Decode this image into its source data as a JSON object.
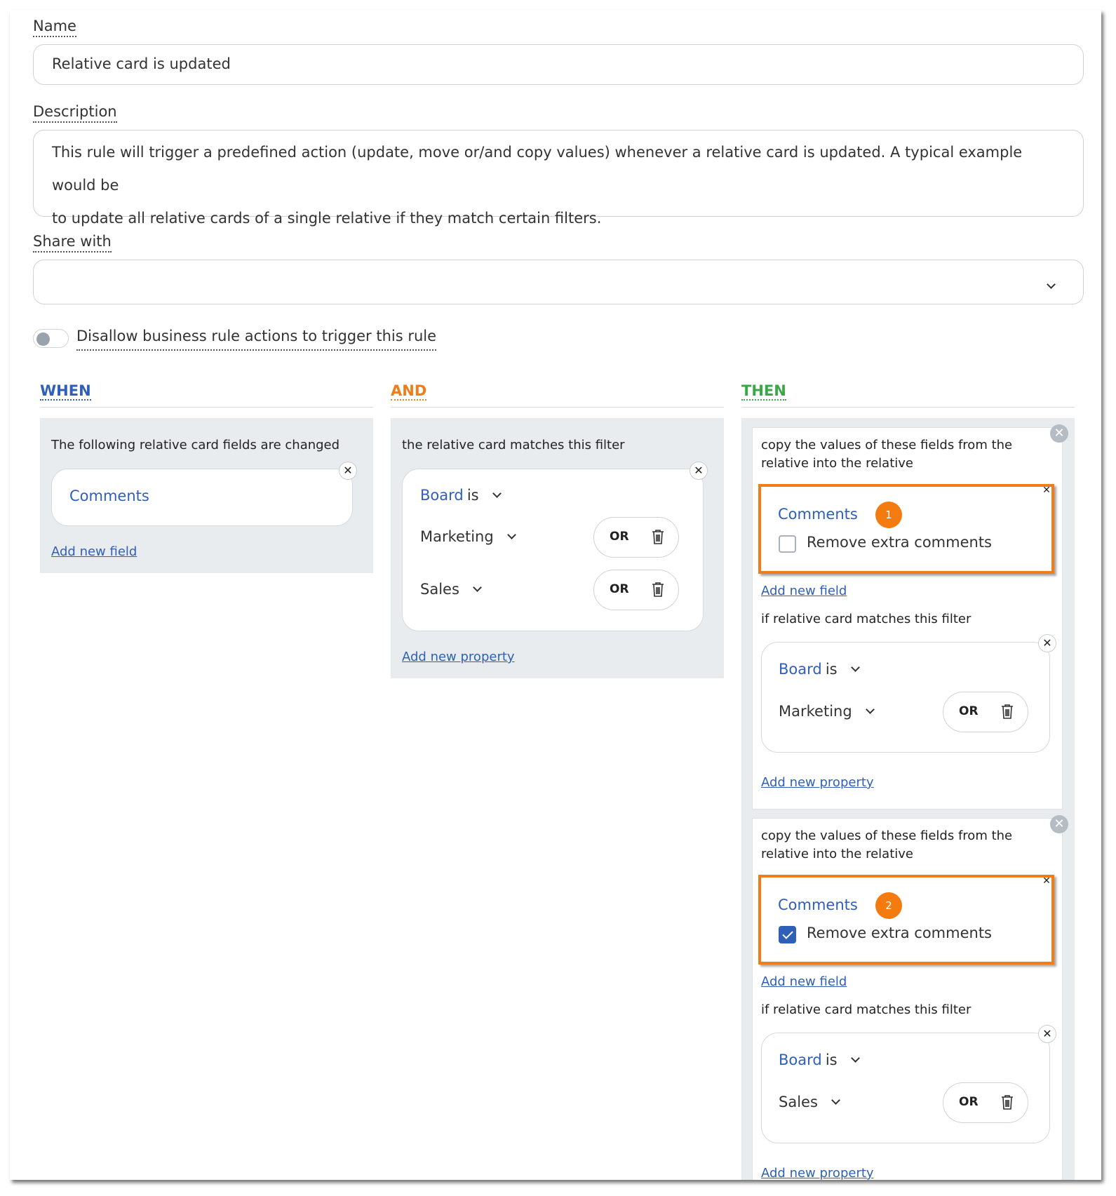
{
  "form": {
    "name_label": "Name",
    "name_value": "Relative card is updated",
    "description_label": "Description",
    "description_line1": "This rule will trigger a predefined action (update, move or/and copy values) whenever a relative card is updated. A typical example would be",
    "description_line2": "to update all relative cards of a single relative if they match certain filters.",
    "share_label": "Share with",
    "share_value": "",
    "toggle_label": "Disallow business rule actions to trigger this rule"
  },
  "columns": {
    "when": "WHEN",
    "and": "AND",
    "then": "THEN"
  },
  "colors": {
    "when": "#2f5fb8",
    "and": "#f07d1a",
    "then": "#3aa845",
    "highlight": "#f07d1a",
    "link": "#2f5fb8"
  },
  "when_panel": {
    "title": "The following relative card fields are changed",
    "field": "Comments",
    "add_link": "Add new field"
  },
  "and_panel": {
    "title": "the relative card matches this filter",
    "property_name": "Board",
    "property_op": "is",
    "values": [
      "Marketing",
      "Sales"
    ],
    "or_label": "OR",
    "add_link": "Add new property"
  },
  "then_actions": [
    {
      "title_line1": "copy the values of these fields from the",
      "title_line2": "relative into the relative",
      "field": "Comments",
      "badge": "1",
      "checkbox_label": "Remove extra comments",
      "checked": false,
      "add_field_link": "Add new field",
      "filter_title": "if relative card matches this filter",
      "property_name": "Board",
      "property_op": "is",
      "value": "Marketing",
      "or_label": "OR",
      "add_property_link": "Add new property"
    },
    {
      "title_line1": "copy the values of these fields from the",
      "title_line2": "relative into the relative",
      "field": "Comments",
      "badge": "2",
      "checkbox_label": "Remove extra comments",
      "checked": true,
      "add_field_link": "Add new field",
      "filter_title": "if relative card matches this filter",
      "property_name": "Board",
      "property_op": "is",
      "value": "Sales",
      "or_label": "OR",
      "add_property_link": "Add new property"
    }
  ]
}
